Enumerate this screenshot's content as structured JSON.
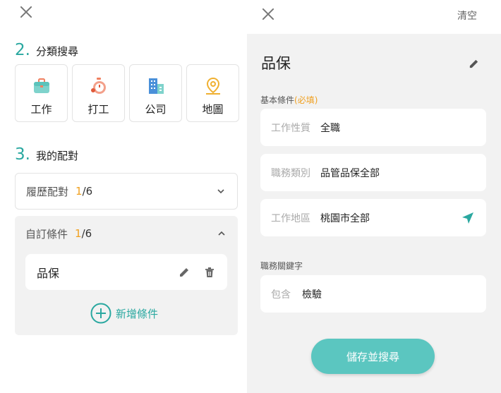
{
  "left": {
    "section_category": {
      "number": "2.",
      "title": "分類搜尋"
    },
    "categories": [
      {
        "label": "工作",
        "icon": "briefcase-icon"
      },
      {
        "label": "打工",
        "icon": "stopwatch-icon"
      },
      {
        "label": "公司",
        "icon": "building-icon"
      },
      {
        "label": "地圖",
        "icon": "map-pin-icon"
      }
    ],
    "section_match": {
      "number": "3.",
      "title": "我的配對"
    },
    "resume_match": {
      "title": "履歷配對",
      "current": "1",
      "total": "/6"
    },
    "custom_conditions": {
      "title": "自訂條件",
      "current": "1",
      "total": "/6",
      "items": [
        {
          "name": "品保"
        }
      ],
      "add_label": "新增條件"
    }
  },
  "right": {
    "clear_label": "清空",
    "condition_title": "品保",
    "basic_label": "基本條件",
    "required_label": "(必填)",
    "fields": [
      {
        "label": "工作性質",
        "value": "全職"
      },
      {
        "label": "職務類別",
        "value": "品管品保全部"
      },
      {
        "label": "工作地區",
        "value": "桃園市全部"
      }
    ],
    "keyword_label": "職務關鍵字",
    "keyword_field": {
      "label": "包含",
      "value": "檢驗"
    },
    "save_label": "儲存並搜尋"
  },
  "colors": {
    "accent": "#2aa8a0",
    "count_highlight": "#f0a020",
    "save_button": "#5bc6c0",
    "panel_bg": "#f2f2f2"
  }
}
